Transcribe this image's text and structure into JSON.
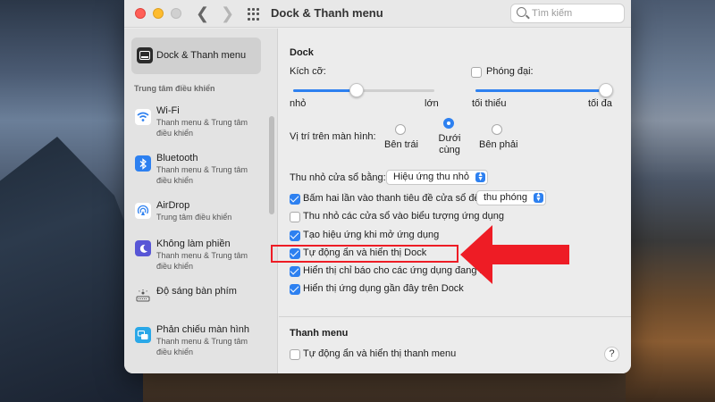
{
  "window": {
    "title": "Dock & Thanh menu"
  },
  "search": {
    "placeholder": "Tìm kiếm"
  },
  "sidebar": {
    "selected": {
      "label": "Dock & Thanh menu"
    },
    "header": "Trung tâm điều khiển",
    "items": [
      {
        "label": "Wi-Fi",
        "sub": "Thanh menu & Trung tâm điều khiển",
        "icon": "wifi-icon"
      },
      {
        "label": "Bluetooth",
        "sub": "Thanh menu & Trung tâm điều khiển",
        "icon": "bluetooth-icon"
      },
      {
        "label": "AirDrop",
        "sub": "Trung tâm điều khiển",
        "icon": "airdrop-icon"
      },
      {
        "label": "Không làm phiền",
        "sub": "Thanh menu & Trung tâm điều khiển",
        "icon": "moon-icon"
      },
      {
        "label": "Độ sáng bàn phím",
        "sub": "",
        "icon": "keyboard-brightness-icon"
      },
      {
        "label": "Phản chiếu màn hình",
        "sub": "Thanh menu & Trung tâm điều khiển",
        "icon": "screen-mirroring-icon"
      }
    ]
  },
  "dock": {
    "title": "Dock",
    "size": {
      "label": "Kích cỡ:",
      "min": "nhỏ",
      "max": "lớn",
      "value": 0.45
    },
    "magnification": {
      "label": "Phóng đại:",
      "checked": false,
      "min": "tối thiểu",
      "max": "tối đa",
      "value": 1.0
    },
    "position": {
      "label": "Vị trí trên màn hình:",
      "options": [
        "Bên trái",
        "Dưới cùng",
        "Bên phải"
      ],
      "selected": "Dưới cùng"
    },
    "minimize": {
      "label": "Thu nhỏ cửa sổ bằng:",
      "value": "Hiệu ứng thu nhỏ"
    },
    "double_click": {
      "label": "Bấm hai lần vào thanh tiêu đề cửa sổ để",
      "value": "thu phóng",
      "checked": true
    },
    "options": [
      {
        "label": "Thu nhỏ các cửa sổ vào biểu tượng ứng dụng",
        "checked": false
      },
      {
        "label": "Tạo hiệu ứng khi mở ứng dụng",
        "checked": true
      },
      {
        "label": "Tự động ẩn và hiển thị Dock",
        "checked": true
      },
      {
        "label": "Hiển thị chỉ báo cho các ứng dụng đang m",
        "checked": true
      },
      {
        "label": "Hiển thị ứng dụng gần đây trên Dock",
        "checked": true
      }
    ]
  },
  "menubar": {
    "title": "Thanh menu",
    "autohide": {
      "label": "Tự động ẩn và hiển thị thanh menu",
      "checked": false
    }
  },
  "colors": {
    "accent": "#2d80f0",
    "annotation": "#ee1c25"
  }
}
